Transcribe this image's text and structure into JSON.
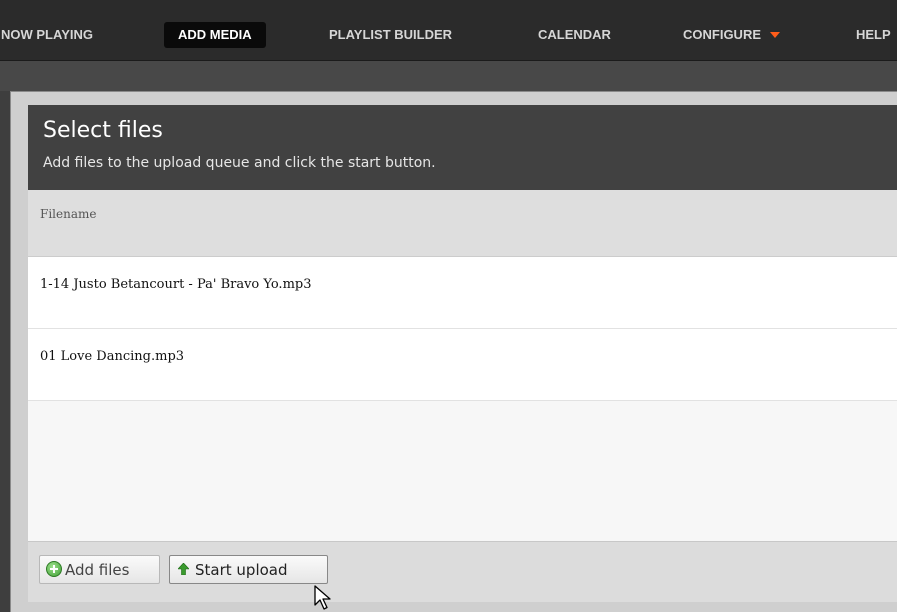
{
  "nav": {
    "items": [
      {
        "label": "NOW PLAYING"
      },
      {
        "label": "ADD MEDIA"
      },
      {
        "label": "PLAYLIST BUILDER"
      },
      {
        "label": "CALENDAR"
      },
      {
        "label": "CONFIGURE"
      },
      {
        "label": "HELP"
      }
    ],
    "active": "ADD MEDIA"
  },
  "uploader": {
    "title": "Select files",
    "subtitle": "Add files to the upload queue and click the start button.",
    "column_header": "Filename",
    "files": [
      {
        "name": "1-14 Justo Betancourt - Pa' Bravo Yo.mp3"
      },
      {
        "name": "01 Love Dancing.mp3"
      }
    ],
    "add_files_label": "Add files",
    "start_upload_label": "Start upload"
  },
  "icons": {
    "add": "add-circle-icon",
    "upload": "arrow-up-icon",
    "configure_dropdown": "caret-down-icon",
    "cursor": "mouse-pointer-icon"
  },
  "colors": {
    "accent": "#ff5d1a",
    "header_bg": "#414141",
    "nav_bg": "#2b2b2b"
  }
}
